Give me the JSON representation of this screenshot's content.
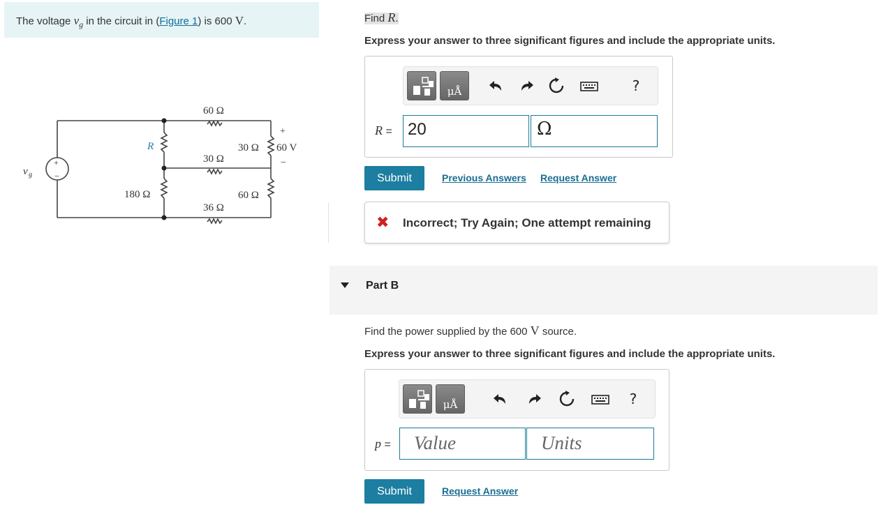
{
  "problem": {
    "text_before": "The voltage ",
    "variable": "v",
    "subscript": "g",
    "text_mid": " in the circuit in (",
    "figure_link": "Figure 1",
    "text_after": ") is 600 ",
    "unit": "V",
    "text_end": "."
  },
  "circuit": {
    "source_label": "v",
    "source_sub": "g",
    "resistors": {
      "top": "60 Ω",
      "mid": "30 Ω",
      "bot": "36 Ω",
      "R": "R",
      "right_top": "30 Ω",
      "right_bot": "60 Ω",
      "left_bot": "180 Ω"
    },
    "voltage_label": "60 V",
    "plus": "+",
    "minus": "−"
  },
  "partA": {
    "question_prefix": "Find ",
    "question_var": "R",
    "question_suffix": ".",
    "instruction": "Express your answer to three significant figures and include the appropriate units.",
    "field_var": "R",
    "field_eq": " =",
    "value": "20",
    "units": "Ω",
    "toolbar": {
      "units_button": "μÅ",
      "help": "?"
    },
    "submit": "Submit",
    "previous_answers": "Previous Answers",
    "request_answer": "Request Answer",
    "feedback": "Incorrect; Try Again; One attempt remaining",
    "feedback_icon": "✖"
  },
  "partB": {
    "title": "Part B",
    "question_prefix": "Find the power supplied by the 600 ",
    "question_unit": "V",
    "question_suffix": " source.",
    "instruction": "Express your answer to three significant figures and include the appropriate units.",
    "field_var": "p",
    "field_eq": " =",
    "value_placeholder": "Value",
    "units_placeholder": "Units",
    "toolbar": {
      "units_button": "μÅ",
      "help": "?"
    },
    "submit": "Submit",
    "request_answer": "Request Answer"
  },
  "icons": {
    "templates": "templates-icon",
    "undo": "undo-icon",
    "redo": "redo-icon",
    "reset": "reset-icon",
    "keyboard": "keyboard-icon",
    "help": "help-icon"
  },
  "colors": {
    "accent": "#1c7ea1",
    "link": "#1a6e92",
    "error": "#d21f1f",
    "statement_bg": "#e6f4f6"
  }
}
